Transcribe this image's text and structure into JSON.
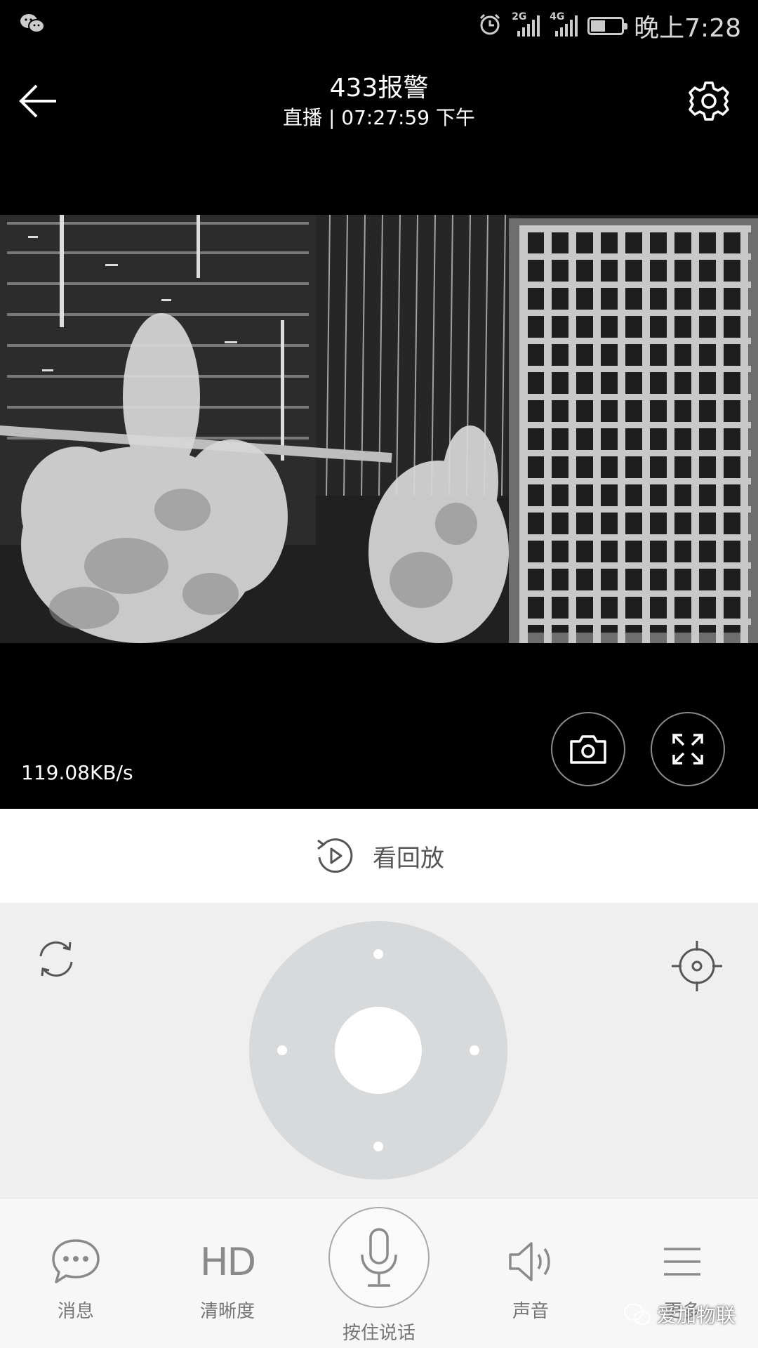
{
  "status_bar": {
    "time": "晚上7:28",
    "network_1": "2G",
    "network_2": "4G",
    "battery_level": 0.45,
    "icons": [
      "wechat-icon",
      "alarm-icon",
      "signal-icon",
      "battery-icon"
    ]
  },
  "header": {
    "title": "433报警",
    "subtitle": "直播 | 07:27:59 下午",
    "back_icon": "arrow-left-icon",
    "settings_icon": "gear-icon"
  },
  "video": {
    "bitrate": "119.08KB/s",
    "snapshot_icon": "camera-icon",
    "fullscreen_icon": "expand-icon"
  },
  "playback": {
    "label": "看回放",
    "icon": "replay-icon"
  },
  "ptz": {
    "rotate_icon": "refresh-icon",
    "target_icon": "crosshair-icon"
  },
  "bottom_bar": {
    "tabs": [
      {
        "label": "消息",
        "icon": "message-icon"
      },
      {
        "label": "清晰度",
        "icon": "HD"
      },
      {
        "label": "声音",
        "icon": "speaker-icon"
      },
      {
        "label": "更多",
        "icon": "menu-icon"
      }
    ],
    "talk_label": "按住说话",
    "talk_icon": "microphone-icon"
  },
  "watermark": {
    "text": "爱加物联"
  }
}
